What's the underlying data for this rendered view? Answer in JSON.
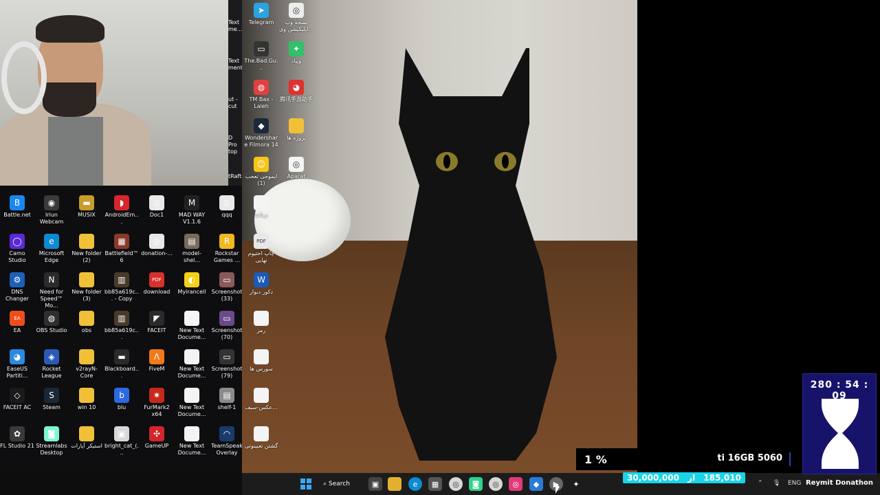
{
  "desktop_left_icons": [
    {
      "label": "Battle.net",
      "color": "#1a86f0",
      "glyph": "B"
    },
    {
      "label": "Iriun Webcam",
      "color": "#3a3a3a",
      "glyph": "◉"
    },
    {
      "label": "MUSIX",
      "color": "#c99b2a",
      "glyph": "▬"
    },
    {
      "label": "AndroidEm...",
      "color": "#d8242c",
      "glyph": "◗"
    },
    {
      "label": "Doc1",
      "color": "#e8e8e8",
      "glyph": "◎"
    },
    {
      "label": "MAD WAY V1.1.6",
      "color": "#222",
      "glyph": "M"
    },
    {
      "label": "qqq",
      "color": "#e8e8e8",
      "glyph": "◎"
    },
    {
      "label": "Camo Studio",
      "color": "#5b2ad6",
      "glyph": "◯"
    },
    {
      "label": "Microsoft Edge",
      "color": "#0c8ad2",
      "glyph": "e"
    },
    {
      "label": "New folder (2)",
      "color": "#f0c138",
      "glyph": ""
    },
    {
      "label": "Battlefield™ 6",
      "color": "#8b3a2a",
      "glyph": "▦"
    },
    {
      "label": "donation-...",
      "color": "#e8e8e8",
      "glyph": "◎"
    },
    {
      "label": "model-shel...",
      "color": "#7a6a5a",
      "glyph": "▤"
    },
    {
      "label": "Rockstar Games ...",
      "color": "#f1b820",
      "glyph": "R"
    },
    {
      "label": "DNS Changer",
      "color": "#1e5fb8",
      "glyph": "⚙"
    },
    {
      "label": "Need for Speed™ Mo...",
      "color": "#2b2b2b",
      "glyph": "N"
    },
    {
      "label": "New folder (3)",
      "color": "#f0c138",
      "glyph": ""
    },
    {
      "label": "bb85a619c... - Copy",
      "color": "#4a3a2a",
      "glyph": "▥"
    },
    {
      "label": "download",
      "color": "#d7312c",
      "glyph": "PDF"
    },
    {
      "label": "Myirancell",
      "color": "#f5cf16",
      "glyph": "◐"
    },
    {
      "label": "Screenshot (33)",
      "color": "#8a5a5a",
      "glyph": "▭"
    },
    {
      "label": "EA",
      "color": "#ef4e1c",
      "glyph": "EA"
    },
    {
      "label": "OBS Studio",
      "color": "#2f2f2f",
      "glyph": "◍"
    },
    {
      "label": "obs",
      "color": "#f0c138",
      "glyph": ""
    },
    {
      "label": "bb85a619c...",
      "color": "#4a3a2a",
      "glyph": "▥"
    },
    {
      "label": "FACEIT",
      "color": "#2a2a2a",
      "glyph": "◤"
    },
    {
      "label": "New Text Docume...",
      "color": "#f4f4f4",
      "glyph": ""
    },
    {
      "label": "Screenshot (70)",
      "color": "#6a4a8a",
      "glyph": "▭"
    },
    {
      "label": "EaseUS Partiti...",
      "color": "#2b8ae0",
      "glyph": "◕"
    },
    {
      "label": "Rocket League",
      "color": "#2a5ab8",
      "glyph": "◈"
    },
    {
      "label": "v2rayN-Core",
      "color": "#f0c138",
      "glyph": ""
    },
    {
      "label": "Blackboard...",
      "color": "#2a2a2a",
      "glyph": "▬"
    },
    {
      "label": "FiveM",
      "color": "#f07a1a",
      "glyph": "Λ"
    },
    {
      "label": "New Text Docume...",
      "color": "#f4f4f4",
      "glyph": ""
    },
    {
      "label": "Screenshot (79)",
      "color": "#333",
      "glyph": "▭"
    },
    {
      "label": "FACEIT AC",
      "color": "#1a1a1a",
      "glyph": "◇"
    },
    {
      "label": "Steam",
      "color": "#1b2838",
      "glyph": "S"
    },
    {
      "label": "win 10",
      "color": "#f0c138",
      "glyph": ""
    },
    {
      "label": "blu",
      "color": "#2a6ae0",
      "glyph": "b"
    },
    {
      "label": "FurMark2 x64",
      "color": "#c8281a",
      "glyph": "✷"
    },
    {
      "label": "New Text Docume...",
      "color": "#f4f4f4",
      "glyph": ""
    },
    {
      "label": "shelf-1",
      "color": "#8a8a8a",
      "glyph": "▤"
    },
    {
      "label": "FL Studio 21",
      "color": "#3a3a3a",
      "glyph": "✿"
    },
    {
      "label": "Streamlabs Desktop",
      "color": "#80f5d2",
      "glyph": "◙"
    },
    {
      "label": "استیکر آپارات",
      "color": "#f0c138",
      "glyph": ""
    },
    {
      "label": "bright_cat_(...",
      "color": "#d8d8d8",
      "glyph": "▣"
    },
    {
      "label": "GameUP",
      "color": "#d2262c",
      "glyph": "✣"
    },
    {
      "label": "New Text Docume...",
      "color": "#f4f4f4",
      "glyph": ""
    },
    {
      "label": "TeamSpeak Overlay",
      "color": "#1a3a6a",
      "glyph": "◠"
    }
  ],
  "desktop_right_icons": [
    {
      "label": "Telegram",
      "color": "#2aa3e0",
      "glyph": "➤"
    },
    {
      "label": "نسخه وب اپلیکیشن وی...",
      "color": "#ededed",
      "glyph": "◎"
    },
    {
      "label": "The.Bad.Gu...",
      "color": "#333",
      "glyph": "▭"
    },
    {
      "label": "ویپاد",
      "color": "#33c06a",
      "glyph": "✦"
    },
    {
      "label": "TM Bax - Laleh",
      "color": "#e04040",
      "glyph": "◍"
    },
    {
      "label": "腾讯手游助手",
      "color": "#e03030",
      "glyph": "◕"
    },
    {
      "label": "Wondershare Filmora 14",
      "color": "#1a2a3a",
      "glyph": "◆"
    },
    {
      "label": "پروژه ها",
      "color": "#f0c138",
      "glyph": ""
    },
    {
      "label": "ایموجی تعجب (1)",
      "color": "#f5c518",
      "glyph": "☺"
    },
    {
      "label": "Aparat",
      "color": "#f4f4f4",
      "glyph": "◎"
    },
    {
      "label": "برنامه",
      "color": "#f4f4f4",
      "glyph": ""
    },
    {
      "label": "چاپ احتیوم نهایی",
      "color": "#e8e8e8",
      "glyph": "PDF"
    },
    {
      "label": "دکور دیوار",
      "color": "#1a5ab8",
      "glyph": "W"
    },
    {
      "label": "رمز",
      "color": "#f4f4f4",
      "glyph": ""
    },
    {
      "label": "سورس ها",
      "color": "#f4f4f4",
      "glyph": ""
    },
    {
      "label": "عکس-سیف...",
      "color": "#f4f4f4",
      "glyph": ""
    },
    {
      "label": "گشتن تعیینوتی",
      "color": "#f4f4f4",
      "glyph": ""
    }
  ],
  "desktop_cut_labels": [
    "Text me...",
    "Text ment",
    "ut - cut",
    "D Pro top",
    "tRaft"
  ],
  "taskbar": {
    "search_label": "Search",
    "tray_lang": "ENG"
  },
  "overlay": {
    "gpu_percent": "1 %",
    "gpu_name": "ti 16GB 5060",
    "donation_goal": "30,000,000",
    "donation_sep": "از",
    "donation_current": "185,010",
    "timer": "280 : 54 : 09",
    "timer_caption": "Reymit Donathon"
  },
  "colors": {
    "donation_bar": "#19d4e8",
    "timer_bg": "#17136b",
    "taskbar_bg": "#1c1c1c"
  }
}
